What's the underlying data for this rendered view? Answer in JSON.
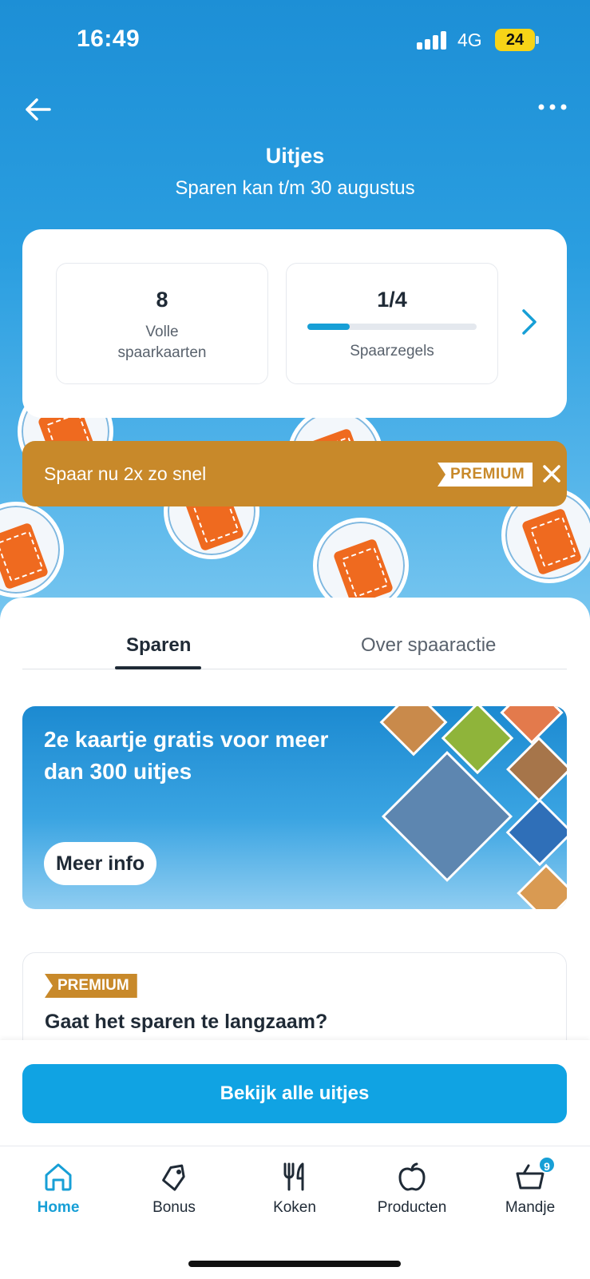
{
  "status_bar": {
    "time": "16:49",
    "network": "4G",
    "battery": "24"
  },
  "header": {
    "title": "Uitjes",
    "subtitle": "Sparen kan t/m 30 augustus"
  },
  "stats": {
    "full_cards_value": "8",
    "full_cards_label": "Volle spaarkaarten",
    "stamps_value": "1/4",
    "stamps_label": "Spaarzegels",
    "stamps_progress": 0.25
  },
  "promo": {
    "text": "Spaar nu 2x zo snel",
    "badge": "PREMIUM"
  },
  "tabs": [
    {
      "label": "Sparen",
      "active": true
    },
    {
      "label": "Over spaaractie",
      "active": false
    }
  ],
  "banner": {
    "title": "2e kaartje gratis voor meer dan 300 uitjes",
    "button": "Meer info"
  },
  "premium_card": {
    "badge": "PREMIUM",
    "title": "Gaat het sparen te langzaam?"
  },
  "cta": {
    "label": "Bekijk alle uitjes"
  },
  "bottom_nav": [
    {
      "label": "Home",
      "icon": "home-icon",
      "active": true
    },
    {
      "label": "Bonus",
      "icon": "tag-icon",
      "active": false
    },
    {
      "label": "Koken",
      "icon": "cutlery-icon",
      "active": false
    },
    {
      "label": "Producten",
      "icon": "apple-icon",
      "active": false
    },
    {
      "label": "Mandje",
      "icon": "basket-icon",
      "active": false,
      "badge": "9"
    }
  ],
  "colors": {
    "primary": "#179fd6",
    "premium": "#c8892a",
    "text": "#1f2a36",
    "cta": "#10a3e3"
  }
}
